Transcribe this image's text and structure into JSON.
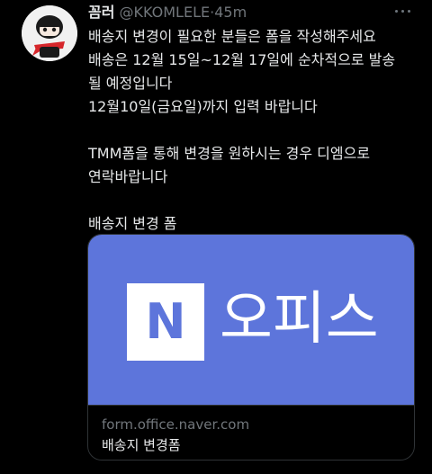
{
  "tweet": {
    "display_name": "꼼러",
    "handle": "@KKOMLELE",
    "separator": "·",
    "time": "45m",
    "lines": [
      "배송지 변경이 필요한 분들은 폼을 작성해주세요",
      "배송은 12월 15일~12월 17일에 순차적으로 발송",
      "될 예정입니다",
      "12월10일(금요일)까지 입력 바랍니다",
      "",
      "TMM폼을 통해 변경을 원하시는 경우 디엠으로",
      "연락바랍니다",
      "",
      "배송지 변경 폼"
    ]
  },
  "card": {
    "logo_letter": "N",
    "brand_text": "오피스",
    "domain": "form.office.naver.com",
    "title": "배송지 변경폼"
  },
  "icons": {
    "more": "more-horizontal-icon",
    "avatar": "avatar-image"
  },
  "colors": {
    "background": "#000000",
    "text": "#e7e9ea",
    "muted": "#71767b",
    "card_brand": "#5d75db",
    "border": "#2f3336"
  }
}
